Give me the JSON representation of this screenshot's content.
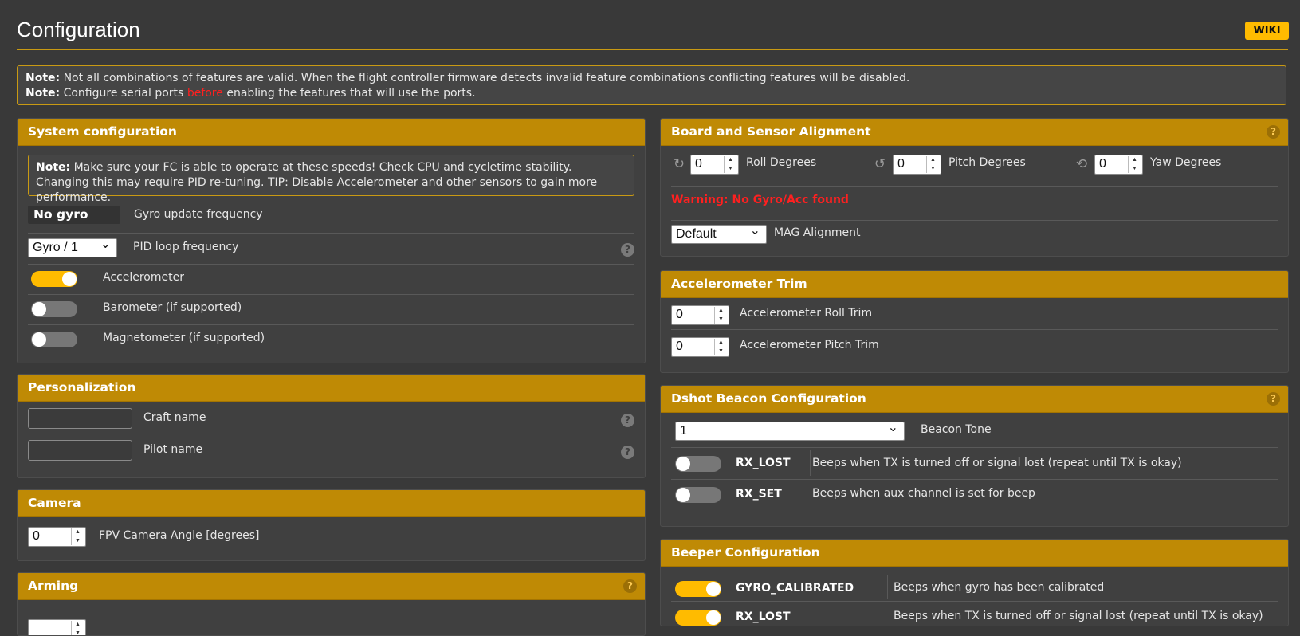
{
  "header": {
    "title": "Configuration",
    "wiki_label": "WIKI"
  },
  "notes": {
    "note_label": "Note:",
    "line1": "Not all combinations of features are valid. When the flight controller firmware detects invalid feature combinations conflicting features will be disabled.",
    "line2_pre": "Configure serial ports",
    "line2_highlight": "before",
    "line2_post": "enabling the features that will use the ports."
  },
  "system": {
    "title": "System configuration",
    "note": "Make sure your FC is able to operate at these speeds! Check CPU and cycletime stability. Changing this may require PID re-tuning. TIP: Disable Accelerometer and other sensors to gain more performance.",
    "gyro_value": "No gyro",
    "gyro_label": "Gyro update frequency",
    "pid_value": "Gyro / 1",
    "pid_label": "PID loop frequency",
    "accel_label": "Accelerometer",
    "accel_on": true,
    "baro_label": "Barometer (if supported)",
    "baro_on": false,
    "mag_label": "Magnetometer (if supported)",
    "mag_on": false
  },
  "personalization": {
    "title": "Personalization",
    "craft_label": "Craft name",
    "craft_value": "",
    "pilot_label": "Pilot name",
    "pilot_value": ""
  },
  "camera": {
    "title": "Camera",
    "angle_value": "0",
    "angle_label": "FPV Camera Angle [degrees]"
  },
  "arming": {
    "title": "Arming"
  },
  "alignment": {
    "title": "Board and Sensor Alignment",
    "roll_value": "0",
    "roll_label": "Roll Degrees",
    "pitch_value": "0",
    "pitch_label": "Pitch Degrees",
    "yaw_value": "0",
    "yaw_label": "Yaw Degrees",
    "warning": "Warning: No Gyro/Acc found",
    "mag_value": "Default",
    "mag_label": "MAG Alignment"
  },
  "acc_trim": {
    "title": "Accelerometer Trim",
    "roll_value": "0",
    "roll_label": "Accelerometer Roll Trim",
    "pitch_value": "0",
    "pitch_label": "Accelerometer Pitch Trim"
  },
  "dshot": {
    "title": "Dshot Beacon Configuration",
    "tone_value": "1",
    "tone_label": "Beacon Tone",
    "items": [
      {
        "name": "RX_LOST",
        "desc": "Beeps when TX is turned off or signal lost (repeat until TX is okay)",
        "on": false
      },
      {
        "name": "RX_SET",
        "desc": "Beeps when aux channel is set for beep",
        "on": false
      }
    ]
  },
  "beeper": {
    "title": "Beeper Configuration",
    "items": [
      {
        "name": "GYRO_CALIBRATED",
        "desc": "Beeps when gyro has been calibrated",
        "on": true
      },
      {
        "name": "RX_LOST",
        "desc": "Beeps when TX is turned off or signal lost (repeat until TX is okay)",
        "on": true
      }
    ]
  },
  "colors": {
    "accent": "#ffbb00",
    "header": "#bf8a05",
    "background": "#393939",
    "warning": "#ff2020"
  },
  "icons": {
    "help": "help-icon",
    "roll": "roll-icon",
    "pitch": "pitch-icon",
    "yaw": "yaw-icon"
  }
}
